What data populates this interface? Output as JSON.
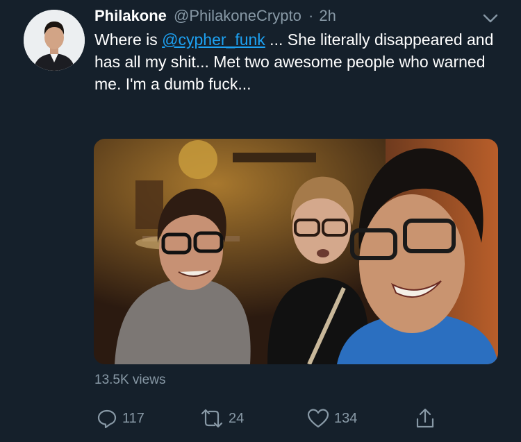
{
  "tweet": {
    "display_name": "Philakone",
    "handle": "@PhilakoneCrypto",
    "separator": "·",
    "time": "2h",
    "text_before": "Where is ",
    "mention": "@cypher_funk",
    "text_after": " ... She literally disappeared and has all my shit... Met two awesome people who warned me. I'm a dumb fuck...",
    "views": "13.5K views"
  },
  "actions": {
    "replies": "117",
    "retweets": "24",
    "likes": "134"
  },
  "icons": {
    "menu": "chevron-down-icon",
    "reply": "reply-icon",
    "retweet": "retweet-icon",
    "like": "heart-icon",
    "share": "share-icon"
  },
  "colors": {
    "background": "#15202b",
    "secondary_text": "#8899a6",
    "link": "#1da1f2"
  }
}
